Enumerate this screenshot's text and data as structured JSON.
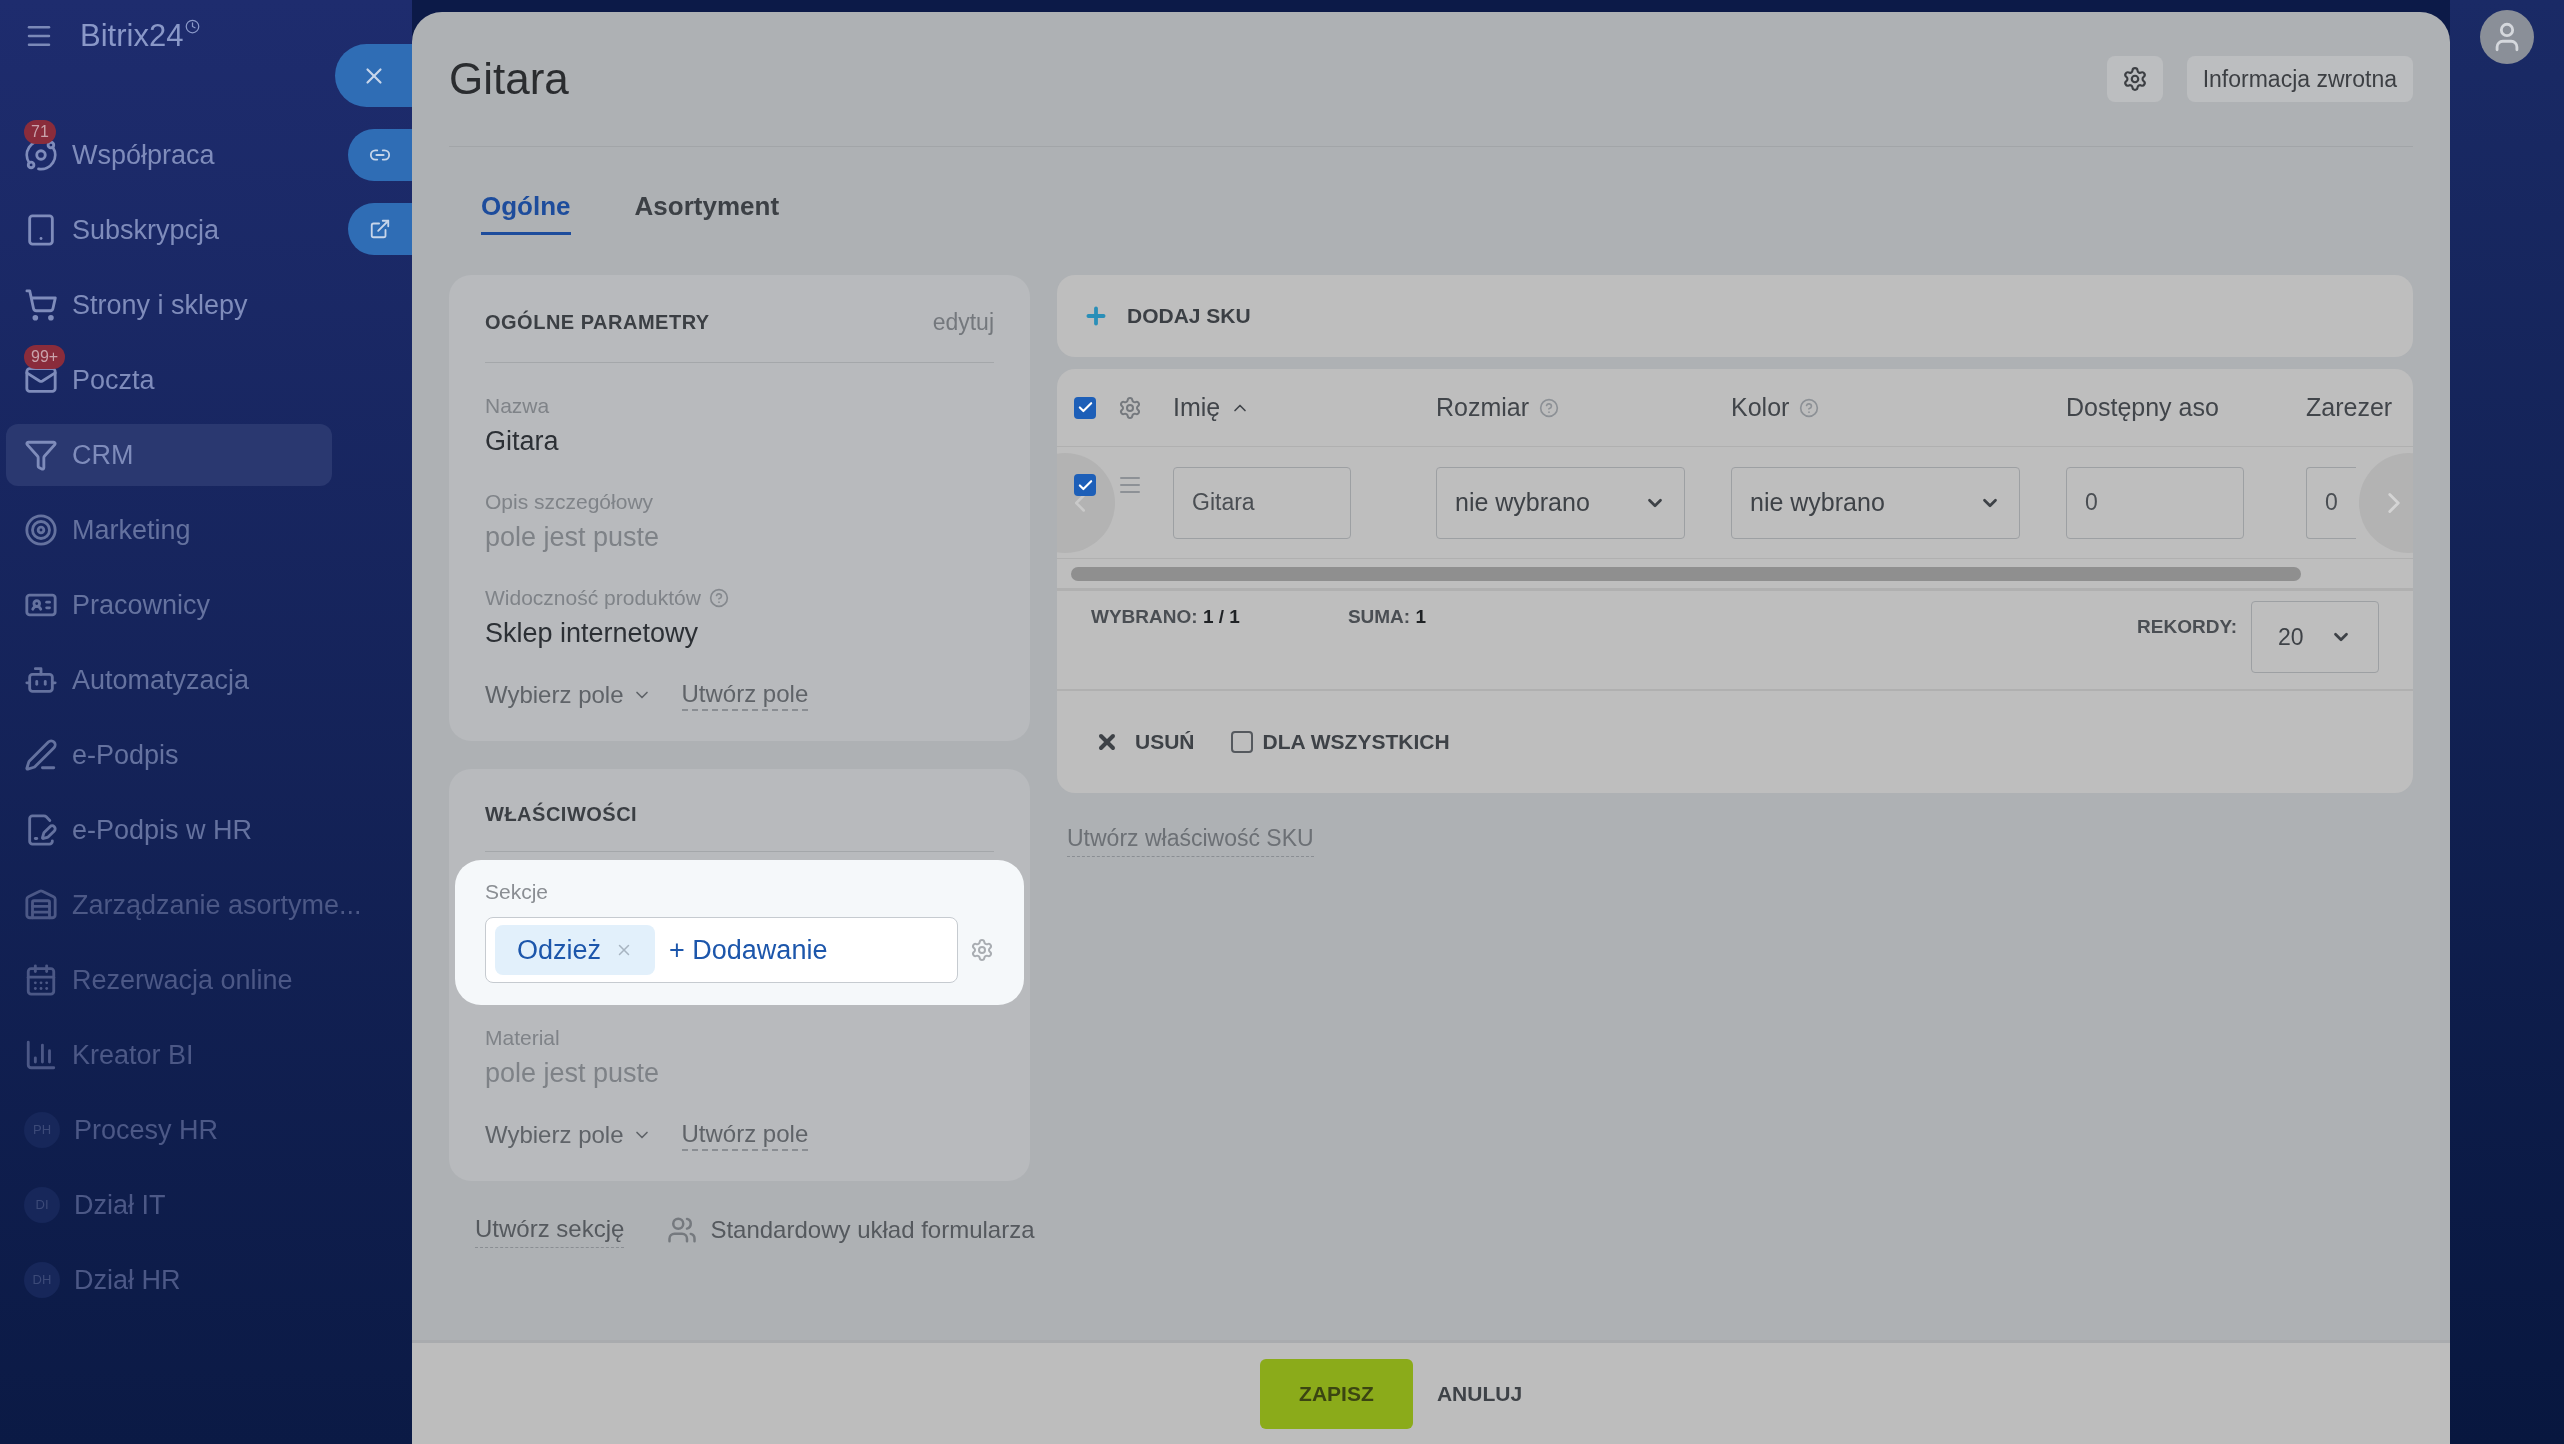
{
  "sidebar": {
    "brand": "Bitrix24",
    "items": [
      {
        "label": "Współpraca",
        "badge": "71",
        "selected": false
      },
      {
        "label": "Subskrypcja",
        "selected": false
      },
      {
        "label": "Strony i sklepy",
        "selected": false
      },
      {
        "label": "Poczta",
        "badge": "99+",
        "selected": false
      },
      {
        "label": "CRM",
        "selected": true
      },
      {
        "label": "Marketing",
        "selected": false
      },
      {
        "label": "Pracownicy",
        "selected": false
      },
      {
        "label": "Automatyzacja",
        "selected": false
      },
      {
        "label": "e-Podpis",
        "selected": false
      },
      {
        "label": "e-Podpis w HR",
        "selected": false
      },
      {
        "label": "Zarządzanie asortyme...",
        "selected": false
      },
      {
        "label": "Rezerwacja online",
        "selected": false
      },
      {
        "label": "Kreator BI",
        "selected": false
      },
      {
        "label": "Procesy HR",
        "initials": "PH",
        "selected": false
      },
      {
        "label": "Dział IT",
        "initials": "DI",
        "selected": false
      },
      {
        "label": "Dział HR",
        "initials": "DH",
        "selected": false
      }
    ]
  },
  "slider": {
    "title": "Gitara",
    "feedback_button": "Informacja zwrotna",
    "tabs": [
      {
        "label": "Ogólne",
        "selected": true
      },
      {
        "label": "Asortyment",
        "selected": false
      }
    ],
    "general_card": {
      "title": "OGÓLNE PARAMETRY",
      "edit_link": "edytuj",
      "fields": [
        {
          "label": "Nazwa",
          "value": "Gitara",
          "empty": false,
          "help": false
        },
        {
          "label": "Opis szczegółowy",
          "value": "pole jest puste",
          "empty": true,
          "help": false
        },
        {
          "label": "Widoczność produktów",
          "value": "Sklep internetowy",
          "empty": false,
          "help": true
        }
      ],
      "select_field": "Wybierz pole",
      "create_field": "Utwórz pole"
    },
    "properties_card": {
      "title": "WŁAŚCIWOŚCI",
      "sections": {
        "label": "Sekcje",
        "tags": [
          "Odzież"
        ],
        "add": "+ Dodawanie"
      },
      "fields": [
        {
          "label": "Material",
          "value": "pole jest puste",
          "empty": true,
          "help": false
        }
      ],
      "select_field": "Wybierz pole",
      "create_field": "Utwórz pole"
    },
    "create_section": "Utwórz sekcję",
    "standard_layout": "Standardowy układ formularza",
    "sku": {
      "add": "DODAJ SKU",
      "all_checked": true,
      "columns": [
        {
          "label": "Imię",
          "sorted": true,
          "help": false
        },
        {
          "label": "Rozmiar",
          "sorted": false,
          "help": true
        },
        {
          "label": "Kolor",
          "sorted": false,
          "help": true
        },
        {
          "label": "Dostępny aso",
          "sorted": false,
          "help": false
        },
        {
          "label": "Zarezer",
          "sorted": false,
          "help": false
        }
      ],
      "rows": [
        {
          "checked": true,
          "cells": [
            {
              "kind": "input",
              "value": "Gitara"
            },
            {
              "kind": "select",
              "value": "nie wybrano"
            },
            {
              "kind": "select",
              "value": "nie wybrano"
            },
            {
              "kind": "input",
              "value": "0"
            },
            {
              "kind": "input",
              "value": "0"
            }
          ]
        }
      ],
      "selected_label": "WYBRANO:",
      "selected_value": "1 / 1",
      "sum_label": "SUMA:",
      "sum_value": "1",
      "records_label": "REKORDY:",
      "records_value": "20",
      "delete": "USUŃ",
      "for_all": {
        "label": "DLA WSZYSTKICH",
        "checked": false
      }
    },
    "create_sku_property": "Utwórz właściwość SKU",
    "save": "ZAPISZ",
    "cancel": "ANULUJ"
  }
}
